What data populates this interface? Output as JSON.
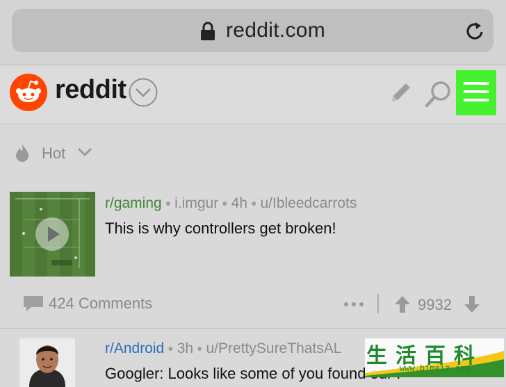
{
  "browser": {
    "url": "reddit.com"
  },
  "header": {
    "wordmark": "reddit"
  },
  "sort": {
    "label": "Hot"
  },
  "posts": [
    {
      "subreddit": "r/gaming",
      "domain": "i.imgur",
      "age": "4h",
      "author": "u/Ibleedcarrots",
      "title": "This is why controllers get broken!",
      "comments": "424 Comments",
      "score": "9932"
    },
    {
      "subreddit": "r/Android",
      "age": "3h",
      "author": "u/PrettySureThatsAL",
      "title": "Googler: Looks like some of you found our F"
    }
  ],
  "watermark": {
    "chars": "生活百科",
    "url": "www.bimeiz.com"
  },
  "colors": {
    "highlight": "#45f12f",
    "reddit_orange": "#ff4500",
    "gaming_sub": "#3a8a2e",
    "android_sub": "#2a6fb8"
  },
  "icons": [
    "lock-icon",
    "reload-icon",
    "reddit-alien-icon",
    "chevron-down-icon",
    "pencil-icon",
    "search-icon",
    "hamburger-menu-icon",
    "flame-icon",
    "play-icon",
    "comment-icon",
    "more-dots-icon",
    "upvote-arrow-icon",
    "downvote-arrow-icon"
  ]
}
